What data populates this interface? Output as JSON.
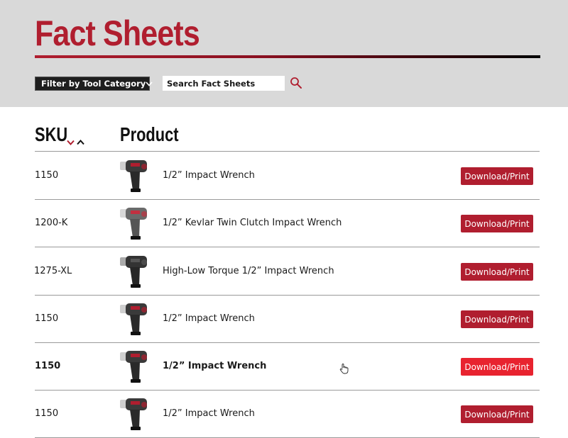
{
  "header": {
    "title": "Fact Sheets",
    "filter_label": "Filter by Tool Category",
    "search_placeholder": "Search Fact Sheets",
    "colors": {
      "brand_red": "#b01e2f",
      "header_bg": "#d9d9d9",
      "button_hover": "#e8232f"
    }
  },
  "table": {
    "columns": {
      "sku": "SKU",
      "product": "Product"
    },
    "sort_icons": [
      "sort-descending-icon",
      "sort-ascending-icon"
    ],
    "rows": [
      {
        "sku": "1150",
        "product": "1/2” Impact Wrench",
        "action": "Download/Print",
        "image": "impact-wrench-black-red"
      },
      {
        "sku": "1200-K",
        "product": "1/2” Kevlar Twin Clutch Impact Wrench",
        "action": "Download/Print",
        "image": "impact-wrench-gray-red"
      },
      {
        "sku": "1275-XL",
        "product": "High-Low Torque 1/2” Impact Wrench",
        "action": "Download/Print",
        "image": "impact-wrench-black"
      },
      {
        "sku": "1150",
        "product": "1/2” Impact Wrench",
        "action": "Download/Print",
        "image": "impact-wrench-black-red"
      },
      {
        "sku": "1150",
        "product": "1/2” Impact Wrench",
        "action": "Download/Print",
        "image": "impact-wrench-black-red",
        "hovered": true
      },
      {
        "sku": "1150",
        "product": "1/2” Impact Wrench",
        "action": "Download/Print",
        "image": "impact-wrench-black-red"
      }
    ]
  }
}
